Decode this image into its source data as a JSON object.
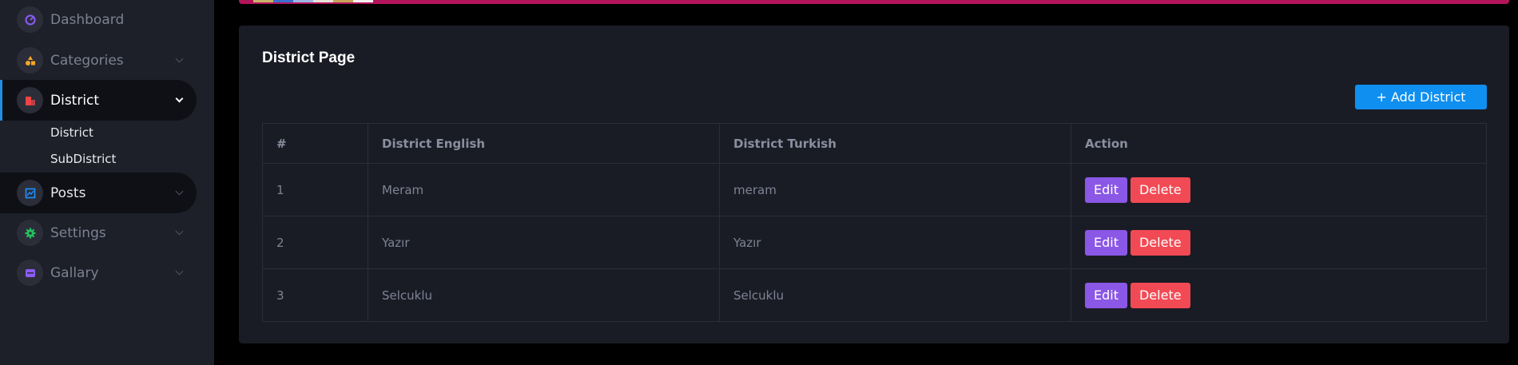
{
  "sidebar": {
    "items": [
      {
        "label": "Dashboard",
        "icon": "dashboard-icon",
        "icon_color": "#8b5cf6"
      },
      {
        "label": "Categories",
        "icon": "categories-icon",
        "icon_color": "#f5a623"
      },
      {
        "label": "District",
        "icon": "district-icon",
        "icon_color": "#ef4444",
        "active": true
      },
      {
        "label": "Posts",
        "icon": "posts-icon",
        "icon_color": "#1e90ff"
      },
      {
        "label": "Settings",
        "icon": "settings-icon",
        "icon_color": "#22c55e"
      },
      {
        "label": "Gallary",
        "icon": "gallery-icon",
        "icon_color": "#8b5cf6"
      }
    ],
    "sub_items": [
      "District",
      "SubDistrict"
    ]
  },
  "page": {
    "title": "District Page",
    "add_button": "+ Add District"
  },
  "table": {
    "headers": [
      "#",
      "District English",
      "District Turkish",
      "Action"
    ],
    "rows": [
      {
        "num": "1",
        "en": "Meram",
        "tr": "meram"
      },
      {
        "num": "2",
        "en": "Yazır",
        "tr": "Yazır"
      },
      {
        "num": "3",
        "en": "Selcuklu",
        "tr": "Selcuklu"
      }
    ],
    "edit_label": "Edit",
    "delete_label": "Delete"
  },
  "colors": {
    "accent": "#0f8ff0",
    "edit": "#8b57e6",
    "delete": "#f24a54",
    "top_bar": "#b3155b"
  }
}
